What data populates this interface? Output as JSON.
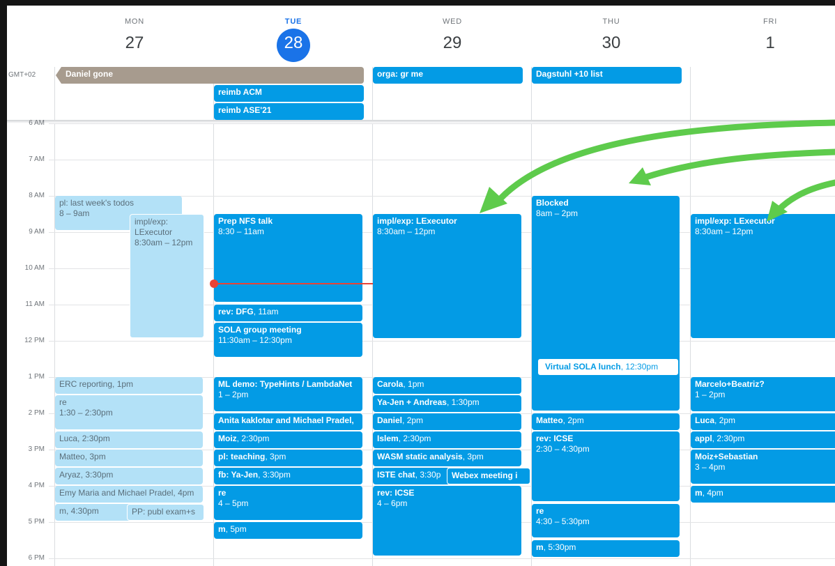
{
  "days": [
    {
      "name": "MON",
      "num": "27"
    },
    {
      "name": "TUE",
      "num": "28"
    },
    {
      "name": "WED",
      "num": "29"
    },
    {
      "name": "THU",
      "num": "30"
    },
    {
      "name": "FRI",
      "num": "1"
    }
  ],
  "timezone": "GMT+02",
  "hours": [
    "6 AM",
    "7 AM",
    "8 AM",
    "9 AM",
    "10 AM",
    "11 AM",
    "12 PM",
    "1 PM",
    "2 PM",
    "3 PM",
    "4 PM",
    "5 PM",
    "6 PM"
  ],
  "allday": {
    "mon_banner": "Daniel gone",
    "tue_1": "reimb ACM",
    "tue_2": "reimb ASE'21",
    "wed_1": "orga: gr me",
    "thu_1": "Dagstuhl +10 list"
  },
  "events": {
    "mon_pl": {
      "title": "pl: last week's todos",
      "time": "8 – 9am"
    },
    "mon_impl": {
      "title": "impl/exp: LExecutor",
      "time": "8:30am – 12pm"
    },
    "mon_erc": {
      "title": "ERC reporting",
      "time": "1pm"
    },
    "mon_re": {
      "title": "re",
      "time": "1:30 – 2:30pm"
    },
    "mon_luca": {
      "title": "Luca",
      "time": "2:30pm"
    },
    "mon_matteo": {
      "title": "Matteo",
      "time": "3pm"
    },
    "mon_aryaz": {
      "title": "Aryaz",
      "time": "3:30pm"
    },
    "mon_emy": {
      "title": "Emy Maria and Michael Pradel",
      "time": "4pm"
    },
    "mon_m": {
      "title": "m",
      "time": "4:30pm"
    },
    "mon_pp": {
      "title": "PP: publ exam+s"
    },
    "tue_prep": {
      "title": "Prep NFS talk",
      "time": "8:30 – 11am"
    },
    "tue_rev": {
      "title": "rev: DFG",
      "time": "11am"
    },
    "tue_sola": {
      "title": "SOLA group meeting",
      "time": "11:30am – 12:30pm"
    },
    "tue_ml": {
      "title": "ML demo: TypeHints / LambdaNet",
      "time": "1 – 2pm"
    },
    "tue_anita": {
      "title": "Anita kaklotar and Michael Pradel,"
    },
    "tue_moiz": {
      "title": "Moiz",
      "time": "2:30pm"
    },
    "tue_pl": {
      "title": "pl: teaching",
      "time": "3pm"
    },
    "tue_fb": {
      "title": "fb: Ya-Jen",
      "time": "3:30pm"
    },
    "tue_re": {
      "title": "re",
      "time": "4 – 5pm"
    },
    "tue_m": {
      "title": "m",
      "time": "5pm"
    },
    "wed_impl": {
      "title": "impl/exp: LExecutor",
      "time": "8:30am – 12pm"
    },
    "wed_carola": {
      "title": "Carola",
      "time": "1pm"
    },
    "wed_yajen": {
      "title": "Ya-Jen + Andreas",
      "time": "1:30pm"
    },
    "wed_daniel": {
      "title": "Daniel",
      "time": "2pm"
    },
    "wed_islem": {
      "title": "Islem",
      "time": "2:30pm"
    },
    "wed_wasm": {
      "title": "WASM static analysis",
      "time": "3pm"
    },
    "wed_iste": {
      "title": "ISTE chat",
      "time": "3:30p"
    },
    "wed_webex": {
      "title": "Webex meeting i"
    },
    "wed_rev": {
      "title": "rev: ICSE",
      "time": "4 – 6pm"
    },
    "thu_blocked": {
      "title": "Blocked",
      "time": "8am – 2pm"
    },
    "thu_lunch": {
      "title": "Virtual SOLA lunch",
      "time": "12:30pm"
    },
    "thu_matteo": {
      "title": "Matteo",
      "time": "2pm"
    },
    "thu_rev": {
      "title": "rev: ICSE",
      "time": "2:30 – 4:30pm"
    },
    "thu_re": {
      "title": "re",
      "time": "4:30 – 5:30pm"
    },
    "thu_m": {
      "title": "m",
      "time": "5:30pm"
    },
    "fri_impl": {
      "title": "impl/exp: LExecutor",
      "time": "8:30am – 12pm"
    },
    "fri_marcelo": {
      "title": "Marcelo+Beatriz?",
      "time": "1 – 2pm"
    },
    "fri_luca": {
      "title": "Luca",
      "time": "2pm"
    },
    "fri_appl": {
      "title": "appl",
      "time": "2:30pm"
    },
    "fri_moiz": {
      "title": "Moiz+Sebastian",
      "time": "3 – 4pm"
    },
    "fri_m": {
      "title": "m",
      "time": "4pm"
    }
  },
  "colors": {
    "event_blue": "#039be5",
    "event_light": "#b3e1f7",
    "banner_gray": "#a79b8e",
    "today": "#1a73e8",
    "now_line": "#ea4335",
    "arrow_green": "#5ecb4c"
  }
}
